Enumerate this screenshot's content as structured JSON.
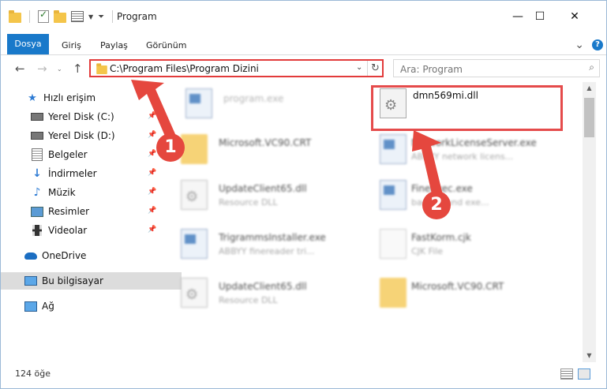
{
  "window": {
    "title": "Program",
    "controls": {
      "minimize": "—",
      "maximize": "☐",
      "close": "✕"
    }
  },
  "ribbon": {
    "tabs": [
      "Dosya",
      "Giriş",
      "Paylaş",
      "Görünüm"
    ],
    "expand_glyph": "⌄",
    "help_glyph": "?"
  },
  "address_bar": {
    "path": "C:\\Program Files\\Program Dizini",
    "search_placeholder": "Ara: Program"
  },
  "sidebar": {
    "items": [
      {
        "label": "Hızlı erişim",
        "icon": "star-icon"
      },
      {
        "label": "Yerel Disk (C:)",
        "icon": "drive-icon",
        "pinned": true
      },
      {
        "label": "Yerel Disk (D:)",
        "icon": "drive-icon",
        "pinned": true
      },
      {
        "label": "Belgeler",
        "icon": "documents-icon",
        "pinned": true
      },
      {
        "label": "İndirmeler",
        "icon": "downloads-icon",
        "pinned": true
      },
      {
        "label": "Müzik",
        "icon": "music-icon",
        "pinned": true
      },
      {
        "label": "Resimler",
        "icon": "pictures-icon",
        "pinned": true
      },
      {
        "label": "Videolar",
        "icon": "videos-icon",
        "pinned": true
      },
      {
        "label": "OneDrive",
        "icon": "onedrive-icon"
      },
      {
        "label": "Bu bilgisayar",
        "icon": "this-pc-icon",
        "selected": true
      },
      {
        "label": "Ağ",
        "icon": "network-icon"
      }
    ]
  },
  "files": [
    {
      "name": "program.exe",
      "desc": "",
      "icon": "exe-icon"
    },
    {
      "name": "dmn569mi.dll",
      "desc": "",
      "icon": "dll-icon"
    },
    {
      "name": "Microsoft.VC90.CRT",
      "desc": "",
      "icon": "folder-icon"
    },
    {
      "name": "NetworkLicenseServer.exe",
      "desc": "ABBYY network licens...",
      "icon": "exe-icon"
    },
    {
      "name": "UpdateClient65.dll",
      "desc": "Resource DLL",
      "icon": "dll-icon"
    },
    {
      "name": "FineExec.exe",
      "desc": "background exe...",
      "icon": "exe-icon"
    },
    {
      "name": "TrigrammsInstaller.exe",
      "desc": "ABBYY finereader tri...",
      "icon": "exe-icon"
    },
    {
      "name": "FastKorm.cjk",
      "desc": "CJK File",
      "icon": "document-icon"
    },
    {
      "name": "UpdateClient65.dll",
      "desc": "Resource DLL",
      "icon": "dll-icon"
    },
    {
      "name": "Microsoft.VC90.CRT",
      "desc": "",
      "icon": "folder-icon"
    }
  ],
  "status_bar": {
    "item_count": "124 öğe"
  },
  "annotations": {
    "step1": "1",
    "step2": "2",
    "color": "#e5473e"
  }
}
